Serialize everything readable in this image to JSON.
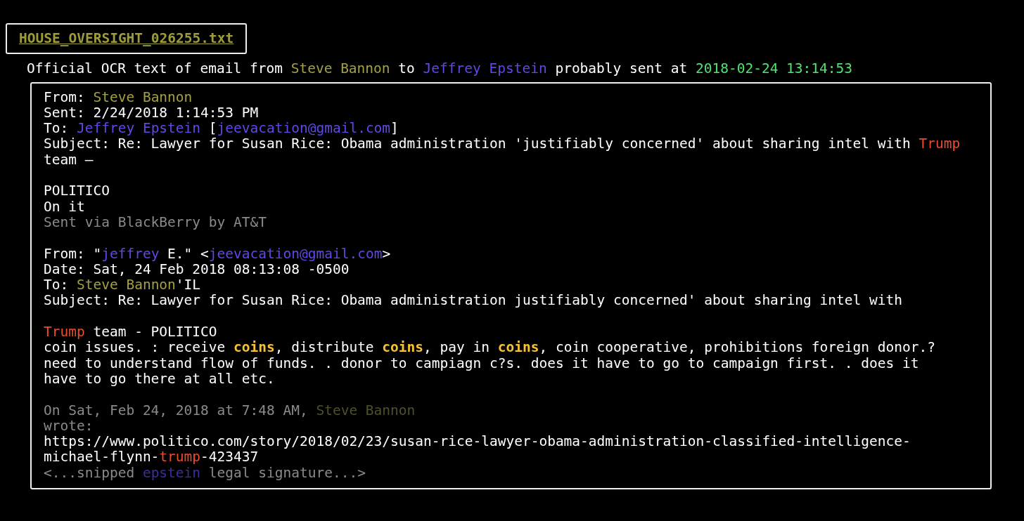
{
  "file_tab": {
    "label": "HOUSE_OVERSIGHT_026255.txt"
  },
  "summary": [
    {
      "text": "Official OCR text of email from ",
      "kind": "plain"
    },
    {
      "text": "Steve Bannon",
      "kind": "bannon"
    },
    {
      "text": " to ",
      "kind": "plain"
    },
    {
      "text": "Jeffrey Epstein",
      "kind": "epstein"
    },
    {
      "text": " probably sent at ",
      "kind": "plain"
    },
    {
      "text": "2018-02-24 13:14:53",
      "kind": "date"
    }
  ],
  "email_lines": [
    {
      "kind": "text",
      "segments": [
        {
          "text": "From: ",
          "kind": "plain"
        },
        {
          "text": "Steve Bannon",
          "kind": "bannon"
        }
      ]
    },
    {
      "kind": "text",
      "segments": [
        {
          "text": "Sent: 2/24/2018 1:14:53 PM",
          "kind": "plain"
        }
      ]
    },
    {
      "kind": "text",
      "segments": [
        {
          "text": "To: ",
          "kind": "plain"
        },
        {
          "text": "Jeffrey Epstein",
          "kind": "epstein"
        },
        {
          "text": " [",
          "kind": "plain"
        },
        {
          "text": "jeevacation@gmail.com",
          "kind": "epstein"
        },
        {
          "text": "]",
          "kind": "plain"
        }
      ]
    },
    {
      "kind": "text",
      "segments": [
        {
          "text": "Subject: Re: Lawyer for Susan Rice: Obama administration 'justifiably concerned' about sharing intel with ",
          "kind": "plain"
        },
        {
          "text": "Trump",
          "kind": "trump"
        }
      ]
    },
    {
      "kind": "text",
      "segments": [
        {
          "text": "team –",
          "kind": "plain"
        }
      ]
    },
    {
      "kind": "blank"
    },
    {
      "kind": "text",
      "segments": [
        {
          "text": "POLITICO",
          "kind": "plain"
        }
      ]
    },
    {
      "kind": "text",
      "segments": [
        {
          "text": "On it",
          "kind": "plain"
        }
      ]
    },
    {
      "kind": "text",
      "segments": [
        {
          "text": "Sent via BlackBerry by AT&T",
          "kind": "dim"
        }
      ]
    },
    {
      "kind": "blank"
    },
    {
      "kind": "text",
      "segments": [
        {
          "text": "From: \"",
          "kind": "plain"
        },
        {
          "text": "jeffrey",
          "kind": "epstein"
        },
        {
          "text": " E.\" <",
          "kind": "plain"
        },
        {
          "text": "jeevacation@gmail.com",
          "kind": "epstein"
        },
        {
          "text": ">",
          "kind": "plain"
        }
      ]
    },
    {
      "kind": "text",
      "segments": [
        {
          "text": "Date: Sat, 24 Feb 2018 08:13:08 -0500",
          "kind": "plain"
        }
      ]
    },
    {
      "kind": "text",
      "segments": [
        {
          "text": "To: ",
          "kind": "plain"
        },
        {
          "text": "Steve Bannon",
          "kind": "bannon"
        },
        {
          "text": "'IL",
          "kind": "plain"
        }
      ]
    },
    {
      "kind": "text",
      "segments": [
        {
          "text": "Subject: Re: Lawyer for Susan Rice: Obama administration justifiably concerned' about sharing intel with",
          "kind": "plain"
        }
      ]
    },
    {
      "kind": "blank"
    },
    {
      "kind": "text",
      "segments": [
        {
          "text": "Trump",
          "kind": "trump"
        },
        {
          "text": " team - POLITICO",
          "kind": "plain"
        }
      ]
    },
    {
      "kind": "text",
      "segments": [
        {
          "text": "coin issues. : receive ",
          "kind": "plain"
        },
        {
          "text": "coins",
          "kind": "coin"
        },
        {
          "text": ", distribute ",
          "kind": "plain"
        },
        {
          "text": "coins",
          "kind": "coin"
        },
        {
          "text": ", pay in ",
          "kind": "plain"
        },
        {
          "text": "coins",
          "kind": "coin"
        },
        {
          "text": ", coin cooperative, prohibitions foreign donor.?",
          "kind": "plain"
        }
      ]
    },
    {
      "kind": "text",
      "segments": [
        {
          "text": "need to understand flow of funds. . donor to campiagn c?s. does it have to go to campaign first. . does it",
          "kind": "plain"
        }
      ]
    },
    {
      "kind": "text",
      "segments": [
        {
          "text": "have to go there at all etc.",
          "kind": "plain"
        }
      ]
    },
    {
      "kind": "blank"
    },
    {
      "kind": "text",
      "segments": [
        {
          "text": "On Sat, Feb 24, 2018 at 7:48 AM, ",
          "kind": "dim"
        },
        {
          "text": "Steve Bannon",
          "kind": "dim-bannon"
        }
      ]
    },
    {
      "kind": "text",
      "segments": [
        {
          "text": "wrote:",
          "kind": "dim"
        }
      ]
    },
    {
      "kind": "text",
      "segments": [
        {
          "text": "https://www.politico.com/story/2018/02/23/susan-rice-lawyer-obama-administration-classified-intelligence-",
          "kind": "plain"
        }
      ]
    },
    {
      "kind": "text",
      "segments": [
        {
          "text": "michael-flynn-",
          "kind": "plain"
        },
        {
          "text": "trump",
          "kind": "trump"
        },
        {
          "text": "-423437",
          "kind": "plain"
        }
      ]
    },
    {
      "kind": "text",
      "segments": [
        {
          "text": "<...snipped ",
          "kind": "dim"
        },
        {
          "text": "epstein",
          "kind": "dim-epstein"
        },
        {
          "text": " legal signature...>",
          "kind": "dim"
        }
      ]
    }
  ]
}
